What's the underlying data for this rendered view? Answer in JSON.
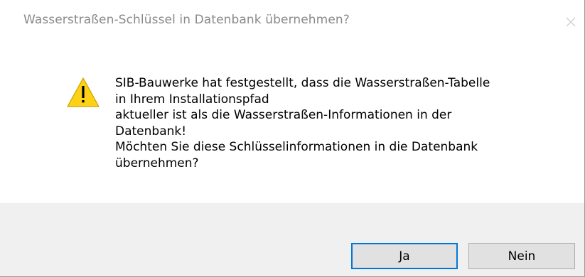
{
  "dialog": {
    "title": "Wasserstraßen-Schlüssel in Datenbank übernehmen?",
    "icon": "warning-icon",
    "message_lines": [
      "SIB-Bauwerke hat festgestellt, dass die Wasserstraßen-Tabelle",
      "in Ihrem Installationspfad",
      "aktueller ist als die Wasserstraßen-Informationen in der",
      "Datenbank!",
      "Möchten Sie diese Schlüsselinformationen in die Datenbank",
      "übernehmen?"
    ],
    "buttons": {
      "yes_label": "Ja",
      "no_label": "Nein"
    }
  },
  "colors": {
    "accent": "#0078d7",
    "warning_fill": "#fcd116",
    "footer_bg": "#f0f0f0"
  }
}
